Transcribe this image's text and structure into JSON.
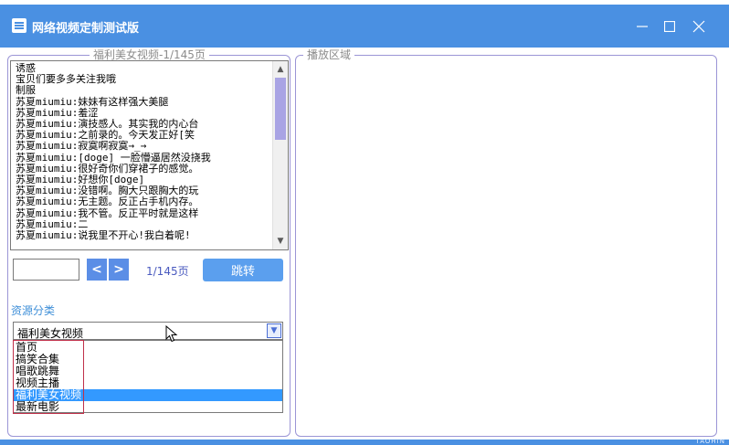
{
  "window": {
    "title": "网络视频定制测试版",
    "controls": [
      "minimize",
      "maximize",
      "close"
    ]
  },
  "video_list_panel": {
    "legend": "福利美女视频-1/145页",
    "items": [
      "诱惑",
      "宝贝们要多多关注我哦",
      "制服",
      "苏夏miumiu:妹妹有这样强大美腿",
      "苏夏miumiu:羞涩",
      "苏夏miumiu:演技感人。其实我的内心台",
      "苏夏miumiu:之前录的。今天发正好[笑",
      "苏夏miumiu:寂寞啊寂寞→_→",
      "苏夏miumiu:[doge]  一脸懵逼居然没挠我",
      "苏夏miumiu:很好奇你们穿裙子的感觉。",
      "苏夏miumiu:好想你[doge]",
      "苏夏miumiu:没错啊。胸大只跟胸大的玩",
      "苏夏miumiu:无主题。反正占手机内存。",
      "苏夏miumiu:我不管。反正平时就是这样",
      "苏夏miumiu:二",
      "苏夏miumiu:说我里不开心!我白着呢!"
    ]
  },
  "pager": {
    "input_value": "",
    "prev_label": "<",
    "next_label": ">",
    "page_info": "1/145页",
    "jump_label": "跳转"
  },
  "category": {
    "label": "资源分类",
    "selected": "福利美女视频",
    "options": [
      "首页",
      "搞笑合集",
      "唱歌跳舞",
      "视频主播",
      "福利美女视频",
      "最新电影"
    ],
    "selected_index": 4
  },
  "player_panel": {
    "legend": "播放区域"
  },
  "footer": {
    "tag": "TAOHIN"
  },
  "colors": {
    "titlebar": "#4a90e2",
    "accent_button": "#5b9fee",
    "selection": "#3399ff",
    "border": "#9b95d6",
    "highlight_box": "#c0304a"
  }
}
